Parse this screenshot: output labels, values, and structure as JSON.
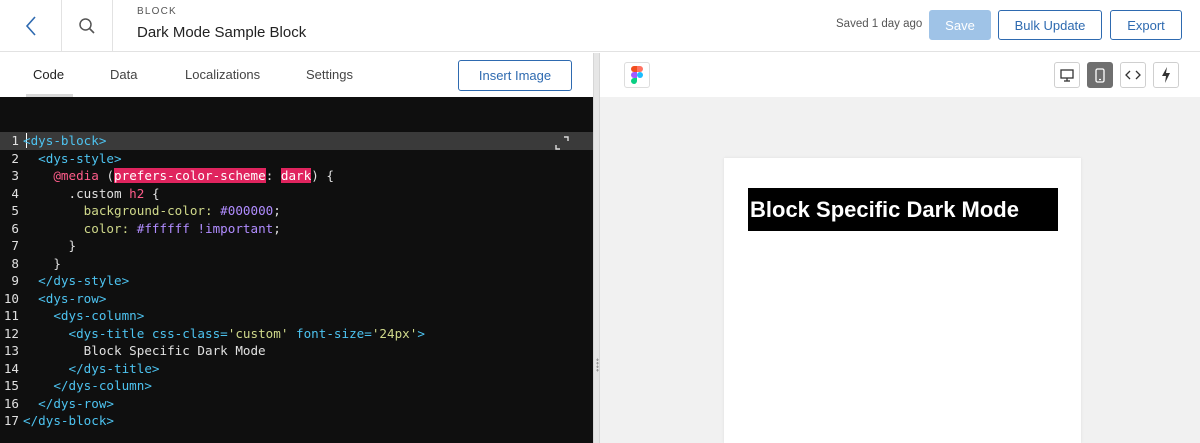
{
  "header": {
    "kicker": "BLOCK",
    "title": "Dark Mode Sample Block",
    "saved_status": "Saved 1 day ago",
    "save_label": "Save",
    "bulk_update_label": "Bulk Update",
    "export_label": "Export"
  },
  "editor_tabs": {
    "items": [
      "Code",
      "Data",
      "Localizations",
      "Settings"
    ],
    "active": "Code",
    "insert_image_label": "Insert Image"
  },
  "code": {
    "line_numbers": [
      "1",
      "2",
      "3",
      "4",
      "5",
      "6",
      "7",
      "8",
      "9",
      "10",
      "11",
      "12",
      "13",
      "14",
      "15",
      "16",
      "17"
    ],
    "lines": {
      "l1_open": "<dys-block>",
      "l2_open": "<dys-style>",
      "l3_media": "@media",
      "l3_paren_open": "(",
      "l3_feature": "prefers-color-scheme",
      "l3_colon": ":",
      "l3_value": "dark",
      "l3_tail": ") {",
      "l4_selector": ".custom",
      "l4_element": "h2",
      "l4_brace": "{",
      "l5_prop": "background-color:",
      "l5_value": "#000000",
      "l5_semi": ";",
      "l6_prop": "color:",
      "l6_value": "#ffffff",
      "l6_important": "!important",
      "l6_semi": ";",
      "l7_close": "}",
      "l8_close": "}",
      "l9_close": "</dys-style>",
      "l10_open": "<dys-row>",
      "l11_open": "<dys-column>",
      "l12_tag": "<dys-title",
      "l12_attr1": "css-class=",
      "l12_val1": "'custom'",
      "l12_attr2": "font-size=",
      "l12_val2": "'24px'",
      "l12_end": ">",
      "l13_text": "Block Specific Dark Mode",
      "l14_close": "</dys-title>",
      "l15_close": "</dys-column>",
      "l16_close": "</dys-row>",
      "l17_close": "</dys-block>"
    }
  },
  "preview": {
    "active_view": "mobile",
    "view_buttons": [
      "desktop-icon",
      "mobile-icon",
      "code-icon",
      "lightning-icon"
    ],
    "rendered_title": "Block Specific Dark Mode"
  },
  "colors": {
    "accent": "#2e6ab0",
    "save_disabled": "#9fc3e7",
    "editor_bg": "#0f0f0f",
    "tag": "#4dc3f0",
    "attribute": "#ff5c8a",
    "string": "#cfd88a",
    "number": "#b08cff",
    "highlight": "#e0245e"
  }
}
